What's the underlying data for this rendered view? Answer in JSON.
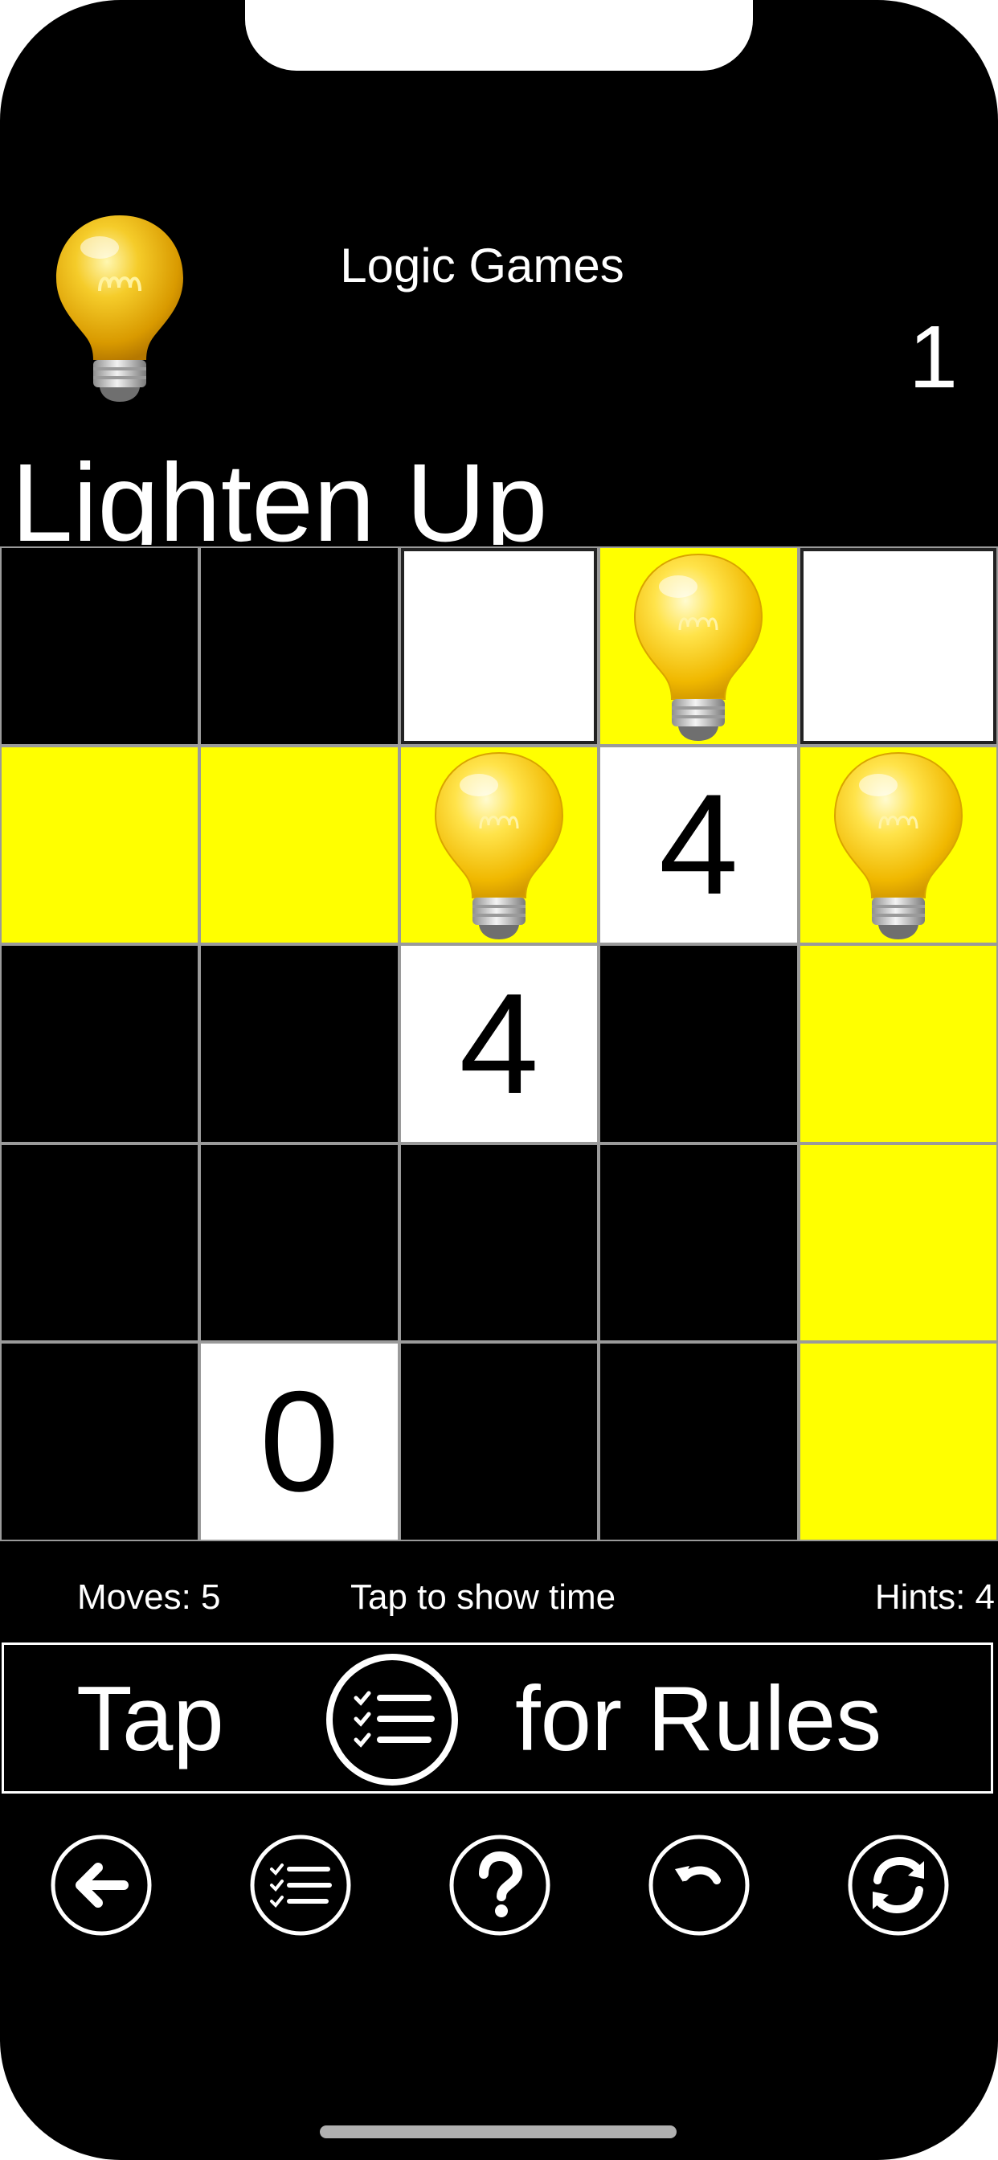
{
  "header": {
    "icon": "lightbulb-icon",
    "app_title": "Logic Games",
    "level": "1"
  },
  "puzzle": {
    "title": "Lighten Up",
    "colors": {
      "wall": "#000000",
      "unlit": "#ffffff",
      "lit": "#ffff00"
    },
    "rows": [
      [
        {
          "type": "black",
          "label": ""
        },
        {
          "type": "black",
          "label": ""
        },
        {
          "type": "white",
          "label": ""
        },
        {
          "type": "bulb",
          "label": ""
        },
        {
          "type": "white",
          "label": ""
        }
      ],
      [
        {
          "type": "lit",
          "label": ""
        },
        {
          "type": "lit",
          "label": ""
        },
        {
          "type": "bulb",
          "label": ""
        },
        {
          "type": "clue",
          "label": "4"
        },
        {
          "type": "bulb",
          "label": ""
        }
      ],
      [
        {
          "type": "black",
          "label": ""
        },
        {
          "type": "black",
          "label": ""
        },
        {
          "type": "clue",
          "label": "4"
        },
        {
          "type": "black",
          "label": ""
        },
        {
          "type": "lit",
          "label": ""
        }
      ],
      [
        {
          "type": "black",
          "label": ""
        },
        {
          "type": "black",
          "label": ""
        },
        {
          "type": "black",
          "label": ""
        },
        {
          "type": "black",
          "label": ""
        },
        {
          "type": "lit",
          "label": ""
        }
      ],
      [
        {
          "type": "black",
          "label": ""
        },
        {
          "type": "clue",
          "label": "0"
        },
        {
          "type": "black",
          "label": ""
        },
        {
          "type": "black",
          "label": ""
        },
        {
          "type": "lit",
          "label": ""
        }
      ]
    ]
  },
  "status": {
    "moves": "Moves: 5",
    "time": "Tap to show time",
    "hints": "Hints: 4"
  },
  "rules_banner": {
    "tap": "Tap",
    "icon": "checklist-icon",
    "text": "for Rules"
  },
  "toolbar": [
    {
      "icon": "back-arrow-icon"
    },
    {
      "icon": "checklist-icon"
    },
    {
      "icon": "question-icon"
    },
    {
      "icon": "undo-icon"
    },
    {
      "icon": "refresh-icon"
    }
  ]
}
